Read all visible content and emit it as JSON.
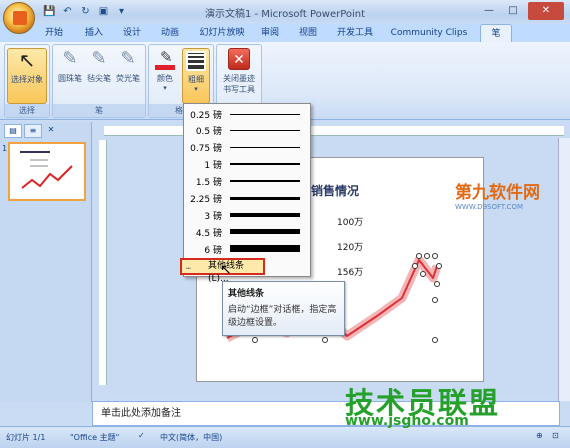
{
  "window": {
    "title": "演示文稿1 - Microsoft PowerPoint"
  },
  "qat": {
    "save": "💾",
    "undo": "↶",
    "redo": "↻",
    "print": "▣",
    "more": "▾"
  },
  "tabs": [
    "开始",
    "插入",
    "设计",
    "动画",
    "幻灯片放映",
    "审阅",
    "视图",
    "开发工具",
    "Community Clips",
    "笔"
  ],
  "ribbon": {
    "select_object": "选择对象",
    "select_group": "选择",
    "ballpoint": "圆珠笔",
    "felt_tip": "毡尖笔",
    "highlighter": "荧光笔",
    "pens_group": "笔",
    "color": "颜色",
    "weight": "粗细",
    "format_group": "格",
    "close_ink_1": "关闭墨迹",
    "close_ink_2": "书写工具"
  },
  "weight_menu": {
    "items": [
      "0.25 磅",
      "0.5 磅",
      "0.75 磅",
      "1 磅",
      "1.5 磅",
      "2.25 磅",
      "3 磅",
      "4.5 磅",
      "6 磅"
    ],
    "more_lines": "其他线条(L)..."
  },
  "tooltip": {
    "title": "其他线条",
    "body": "启动“边框”对话框，指定高级边框设置。"
  },
  "slide": {
    "title": "销售情况",
    "labels": [
      "100万",
      "120万",
      "156万"
    ]
  },
  "notes": {
    "placeholder": "单击此处添加备注"
  },
  "status": {
    "slide_index": "幻灯片 1/1",
    "theme": "\"Office 主题\"",
    "language": "中文(简体，中国)"
  },
  "watermarks": {
    "top": "第九软件网",
    "top_url": "WWW.D9SOFT.COM",
    "bottom": "技术员联盟",
    "bottom_url": "www.jsgho.com"
  },
  "colors": {
    "accent": "#15428b",
    "highlight": "#fde9a9",
    "red_box": "#d52b1e",
    "ink": "#e0303a"
  }
}
